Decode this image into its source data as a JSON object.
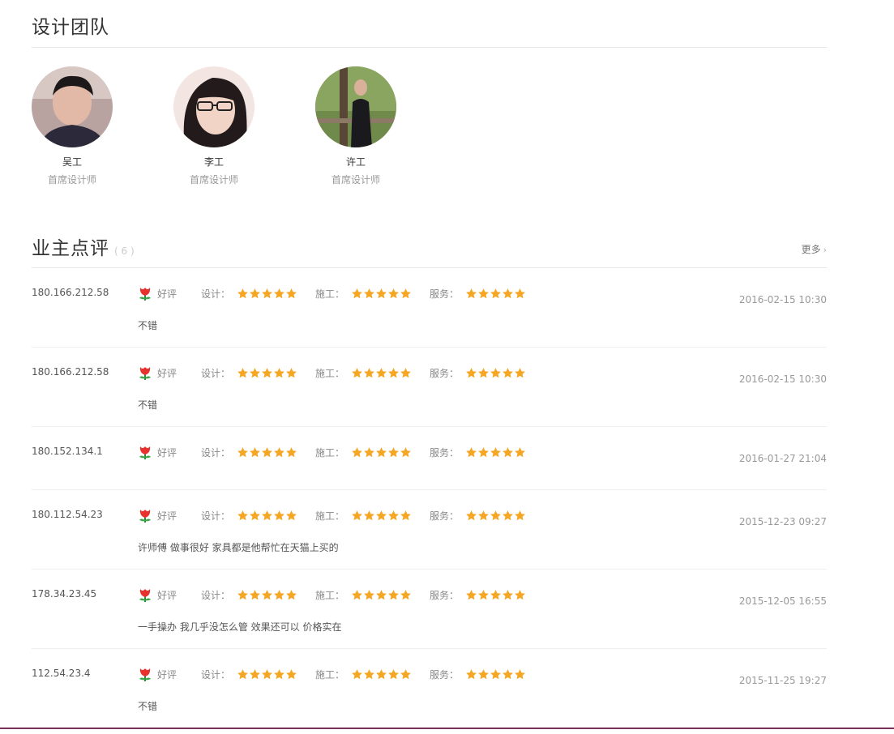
{
  "team": {
    "title": "设计团队",
    "members": [
      {
        "name": "吴工",
        "role": "首席设计师"
      },
      {
        "name": "李工",
        "role": "首席设计师"
      },
      {
        "name": "许工",
        "role": "首席设计师"
      }
    ]
  },
  "reviews_section": {
    "title": "业主点评",
    "count": "( 6 )",
    "more_label": "更多",
    "rating_good_label": "好评",
    "category_labels": {
      "design": "设计：",
      "construction": "施工：",
      "service": "服务："
    },
    "star_color": "#f5a623",
    "items": [
      {
        "ip": "180.166.212.58",
        "design_stars": 5,
        "construction_stars": 5,
        "service_stars": 5,
        "date": "2016-02-15 10:30",
        "comment": "不错"
      },
      {
        "ip": "180.166.212.58",
        "design_stars": 5,
        "construction_stars": 5,
        "service_stars": 5,
        "date": "2016-02-15 10:30",
        "comment": "不错"
      },
      {
        "ip": "180.152.134.1",
        "design_stars": 5,
        "construction_stars": 5,
        "service_stars": 5,
        "date": "2016-01-27 21:04",
        "comment": ""
      },
      {
        "ip": "180.112.54.23",
        "design_stars": 5,
        "construction_stars": 5,
        "service_stars": 5,
        "date": "2015-12-23 09:27",
        "comment": "许师傅 做事很好 家具都是他帮忙在天猫上买的"
      },
      {
        "ip": "178.34.23.45",
        "design_stars": 5,
        "construction_stars": 5,
        "service_stars": 5,
        "date": "2015-12-05 16:55",
        "comment": "一手操办 我几乎没怎么管 效果还可以 价格实在"
      },
      {
        "ip": "112.54.23.4",
        "design_stars": 5,
        "construction_stars": 5,
        "service_stars": 5,
        "date": "2015-11-25 19:27",
        "comment": "不错"
      }
    ]
  }
}
